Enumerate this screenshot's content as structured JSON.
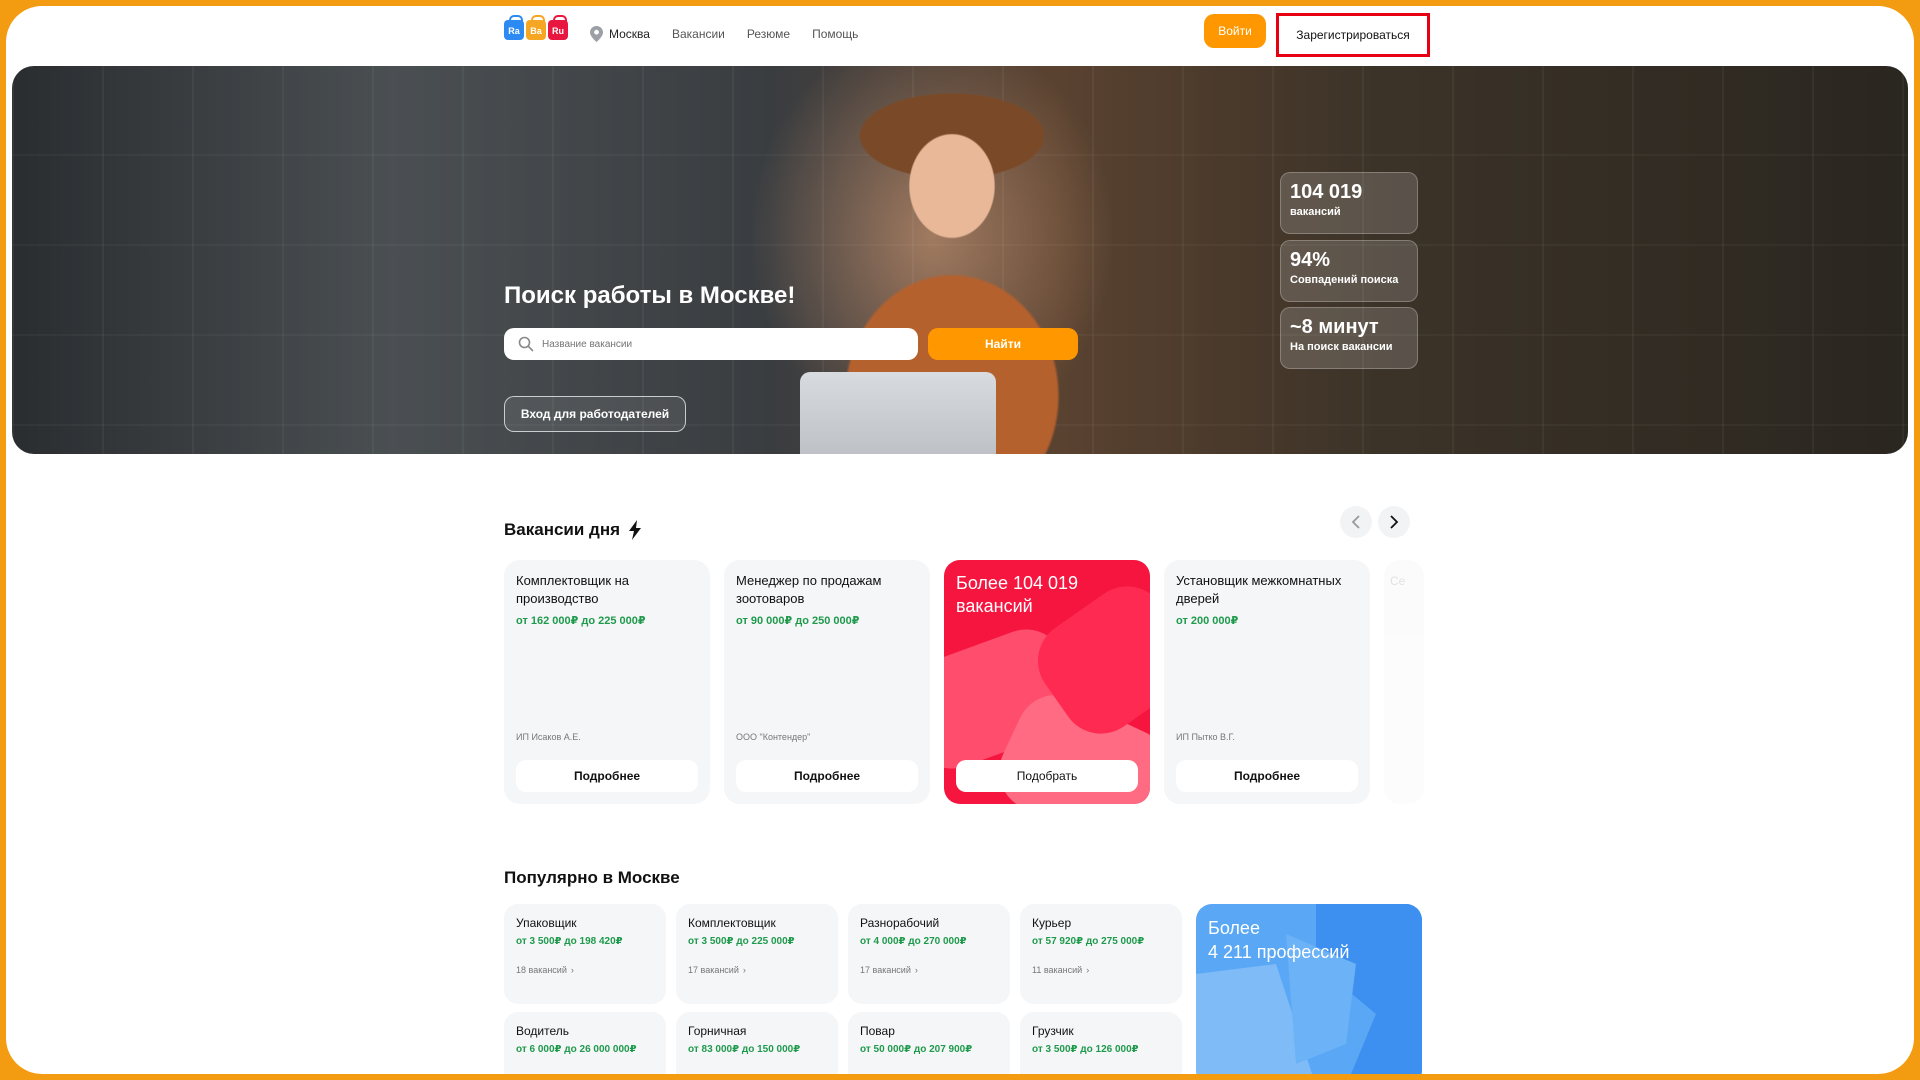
{
  "header": {
    "logo_letters": [
      "Ra",
      "Ba",
      "Ru"
    ],
    "city": "Москва",
    "nav": [
      "Вакансии",
      "Резюме",
      "Помощь"
    ],
    "login": "Войти",
    "register": "Зарегистрироваться"
  },
  "hero": {
    "title": "Поиск работы в Москве!",
    "search_placeholder": "Название вакансии",
    "find": "Найти",
    "employer": "Вход для работодателей",
    "stats": [
      {
        "num": "104 019",
        "label": "вакансий"
      },
      {
        "num": "94%",
        "label": "Совпадений поиска"
      },
      {
        "num": "~8 минут",
        "label": "На поиск вакансии"
      }
    ]
  },
  "vacancies": {
    "title": "Вакансии дня",
    "cards": [
      {
        "title": "Комплектовщик на производство",
        "salary": "от 162 000₽ до 225 000₽",
        "company": "ИП Исаков А.Е.",
        "button": "Подробнее"
      },
      {
        "title": "Менеджер по продажам зоотоваров",
        "salary": "от 90 000₽ до 250 000₽",
        "company": "ООО \"Контендер\"",
        "button": "Подробнее"
      },
      {
        "title": "Установщик межкомнатных дверей",
        "salary": "от 200 000₽",
        "company": "ИП Пытко В.Г.",
        "button": "Подробнее"
      }
    ],
    "promo": {
      "title": "Более 104 019 вакансий",
      "button": "Подобрать"
    },
    "faded_letters": "Се"
  },
  "popular": {
    "title": "Популярно в Москве",
    "items": [
      {
        "name": "Упаковщик",
        "salary": "от 3 500₽ до 198 420₽",
        "count": "18 вакансий"
      },
      {
        "name": "Комплектовщик",
        "salary": "от 3 500₽ до 225 000₽",
        "count": "17 вакансий"
      },
      {
        "name": "Разнорабочий",
        "salary": "от 4 000₽ до 270 000₽",
        "count": "17 вакансий"
      },
      {
        "name": "Курьер",
        "salary": "от 57 920₽ до 275 000₽",
        "count": "11 вакансий"
      },
      {
        "name": "Водитель",
        "salary": "от 6 000₽ до 26 000 000₽",
        "count": ""
      },
      {
        "name": "Горничная",
        "salary": "от 83 000₽ до 150 000₽",
        "count": ""
      },
      {
        "name": "Повар",
        "salary": "от 50 000₽ до 207 900₽",
        "count": ""
      },
      {
        "name": "Грузчик",
        "salary": "от 3 500₽ до 126 000₽",
        "count": ""
      }
    ],
    "promo": {
      "line1": "Более",
      "line2": "4 211 профессий"
    }
  },
  "colors": {
    "accent": "#ff9800",
    "frame": "#f39c12",
    "promo_red": "#f5153f",
    "promo_blue": "#5aa8f5",
    "salary_green": "#1f9a4c",
    "highlight_red": "#e60012"
  }
}
